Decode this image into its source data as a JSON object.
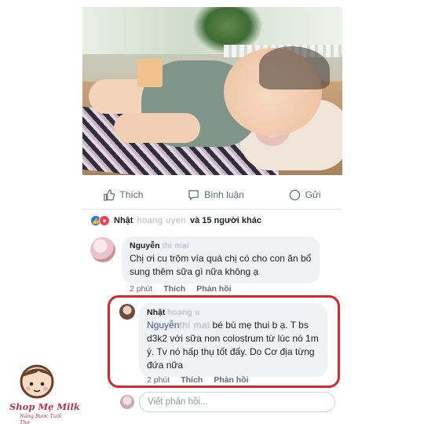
{
  "post": {
    "actions": [
      {
        "label": "Thích",
        "icon": "like-icon"
      },
      {
        "label": "Bình luận",
        "icon": "comment-icon"
      },
      {
        "label": "Gửi",
        "icon": "messenger-icon"
      }
    ],
    "reactions": {
      "name": "Nhật",
      "hidden_name": "hoang uyen",
      "suffix": "và 15 người khác",
      "icons": [
        "like-reaction-icon",
        "love-reaction-icon"
      ]
    }
  },
  "comments": [
    {
      "author": "Nguyễn",
      "author_hidden": "thi mai",
      "text": "Chị ơi cu trộm vía quá chị có cho con ăn bổ sung thêm sữa gì nữa không ạ",
      "time": "2 phút",
      "like_label": "Thích",
      "reply_label": "Phản hồi"
    },
    {
      "author": "Nhật",
      "author_hidden": "hoang u",
      "mention": "Nguyễn",
      "mention_hidden": "thi mai",
      "text": " bé bú mẹ thui b ạ. T bs d3k2 với sữa non colostrum từ lúc nó 1m ý. Tv nó hấp thụ tốt đấy. Do Cơ địa từng đứa nữa",
      "time": "2 phút",
      "like_label": "Thích",
      "reply_label": "Phản hồi"
    }
  ],
  "reply_input": {
    "placeholder": "Viết phản hồi..."
  },
  "watermark": {
    "brand": "Shop Mẹ Milk",
    "tagline": "Nâng Bước Tuổi Thơ"
  },
  "colors": {
    "highlight": "#d9262a",
    "link": "#385898",
    "brand": "#b8324a"
  }
}
